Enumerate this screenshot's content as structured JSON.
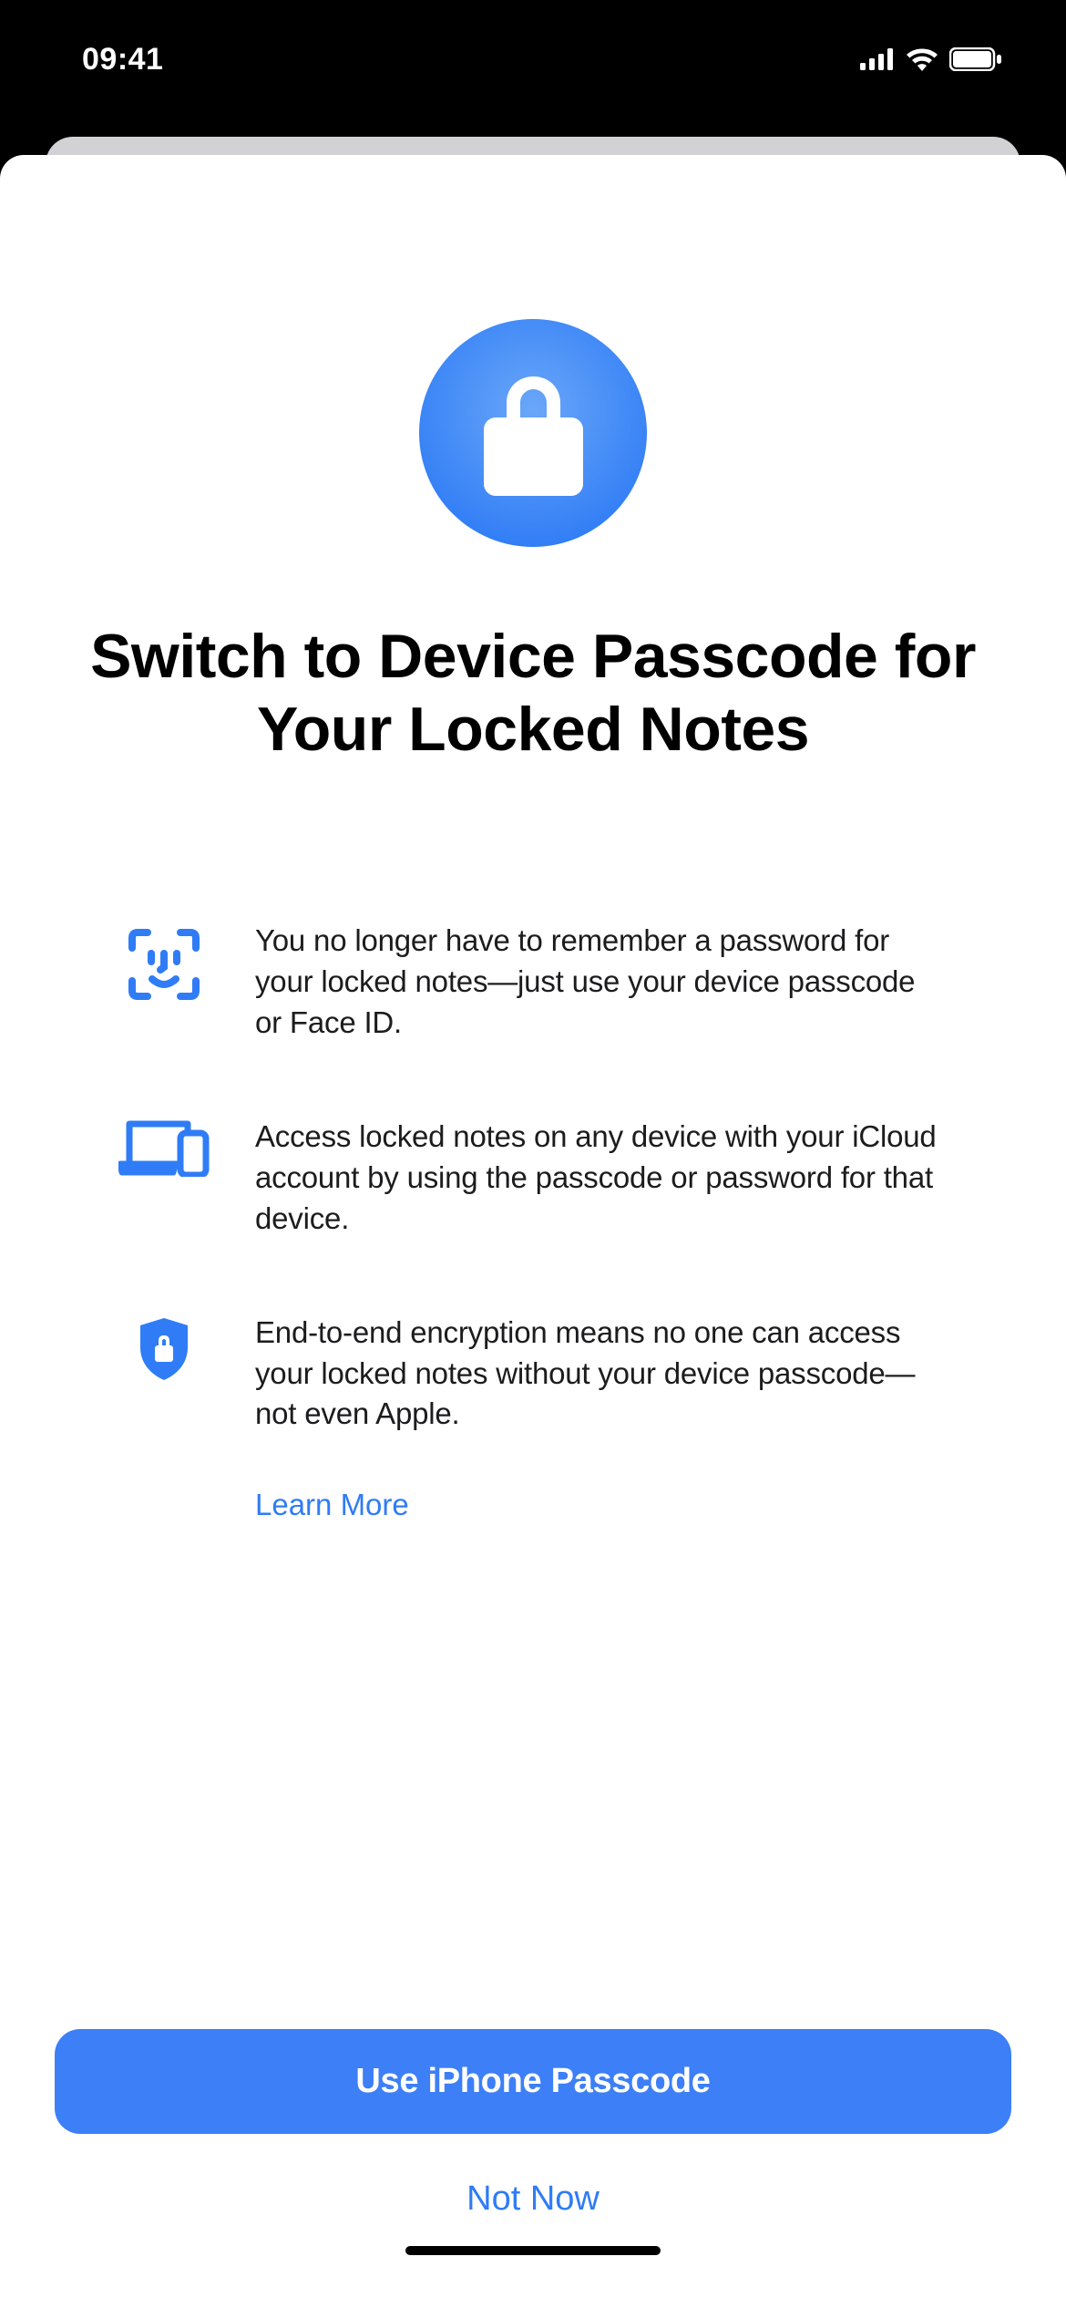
{
  "status": {
    "time": "09:41"
  },
  "sheet": {
    "title": "Switch to Device Passcode for Your Locked Notes",
    "features": [
      {
        "text": "You no longer have to remember a password for your locked notes—just use your device passcode or Face ID."
      },
      {
        "text": "Access locked notes on any device with your iCloud account by using the passcode or password for that device."
      },
      {
        "text": "End-to-end encryption means no one can access your locked notes without your device passcode—not even Apple."
      }
    ],
    "learn_more": "Learn More",
    "primary_button": "Use iPhone Passcode",
    "secondary_button": "Not Now"
  },
  "colors": {
    "accent": "#2f7cf6"
  }
}
